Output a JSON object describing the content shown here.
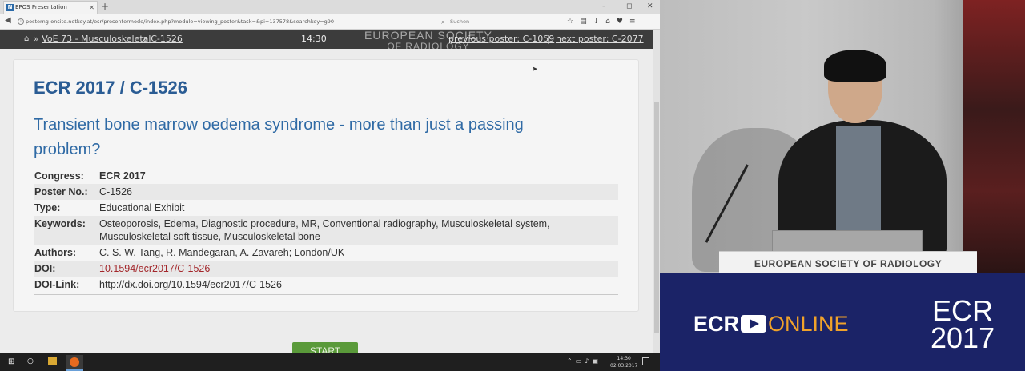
{
  "browser": {
    "tab_title": "EPOS Presentation",
    "tab_icon": "N",
    "new_tab": "+",
    "url": "posterng-onsite.netkey.at/esr/presentermode/index.php?module=viewing_poster&task=&pi=137578&searchkey=g90",
    "search_placeholder": "Suchen",
    "window_minimize": "–",
    "window_maximize": "◻",
    "window_close": "✕"
  },
  "navbar": {
    "crumb1": "VoE 73 - Musculoskeletal",
    "crumb1_prefix": "»",
    "crumb2": "C-1526",
    "crumb2_prefix": "»",
    "time": "14:30",
    "prev_poster": "previous poster: C-1059",
    "separator": "|",
    "next_poster": "next poster: C-2077"
  },
  "overlay_logo": {
    "line1": "EUROPEAN SOCIETY",
    "line2": "OF RADIOLOGY"
  },
  "poster": {
    "heading": "ECR 2017 / C-1526",
    "title": "Transient bone marrow oedema syndrome - more than just a passing problem?",
    "meta": {
      "congress_label": "Congress:",
      "congress_value": "ECR 2017",
      "poster_no_label": "Poster No.:",
      "poster_no_value": "C-1526",
      "type_label": "Type:",
      "type_value": "Educational Exhibit",
      "keywords_label": "Keywords:",
      "keywords_value": "Osteoporosis, Edema, Diagnostic procedure, MR, Conventional radiography, Musculoskeletal system, Musculoskeletal soft tissue, Musculoskeletal bone",
      "authors_label": "Authors:",
      "authors_first": "C. S. W. Tang",
      "authors_rest": ", R. Mandegaran, A. Zavareh; London/UK",
      "doi_label": "DOI:",
      "doi_value": "10.1594/ecr2017/C-1526",
      "doilink_label": "DOI-Link:",
      "doilink_value": "http://dx.doi.org/10.1594/ecr2017/C-1526"
    },
    "start_button": "START"
  },
  "taskbar": {
    "clock_time": "14:30",
    "clock_date": "02.03.2017"
  },
  "video": {
    "podium_text": "EUROPEAN SOCIETY OF RADIOLOGY"
  },
  "banner": {
    "ecr_word": "ECR",
    "online_word": "ONLINE",
    "big_line1": "ECR",
    "big_line2": "2017"
  },
  "colors": {
    "heading_blue": "#2a5c94",
    "doi_red": "#a3262a",
    "banner_navy": "#1b2367",
    "online_orange": "#f0a22a",
    "start_green": "#5a9a3a"
  }
}
